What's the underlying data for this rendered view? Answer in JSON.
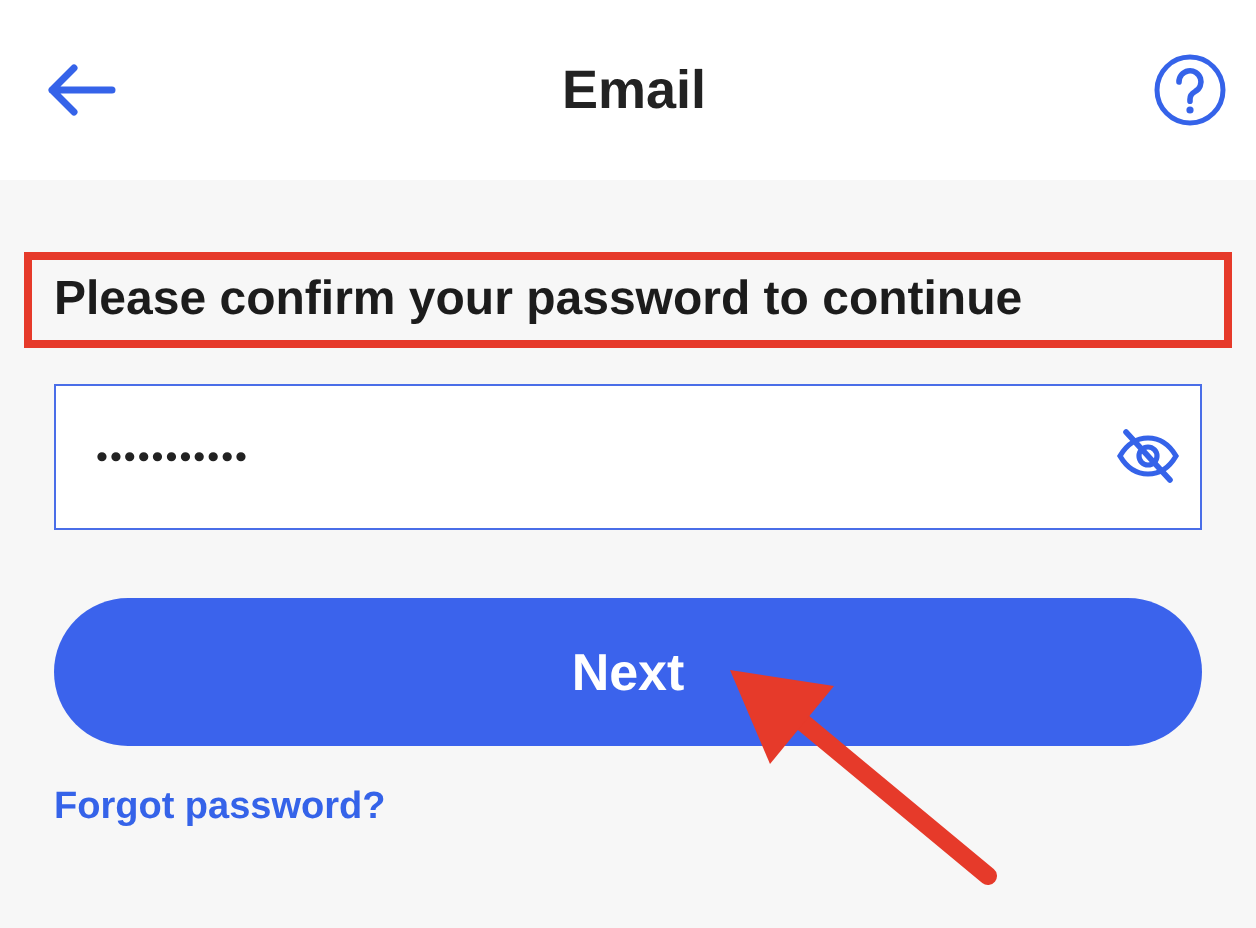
{
  "header": {
    "title": "Email"
  },
  "prompt": "Please confirm your password to continue",
  "password_field": {
    "value": "•••••••••••"
  },
  "next_button": {
    "label": "Next"
  },
  "forgot_link": "Forgot password?"
}
